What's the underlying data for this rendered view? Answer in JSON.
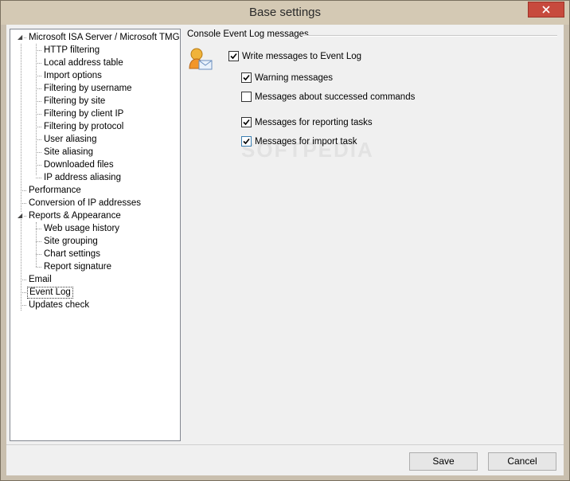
{
  "window": {
    "title": "Base settings"
  },
  "tree": {
    "nodes": [
      {
        "label": "Microsoft ISA Server / Microsoft TMG",
        "level": 0,
        "expanded": true
      },
      {
        "label": "HTTP filtering",
        "level": 1
      },
      {
        "label": "Local address table",
        "level": 1
      },
      {
        "label": "Import options",
        "level": 1
      },
      {
        "label": "Filtering by username",
        "level": 1
      },
      {
        "label": "Filtering by site",
        "level": 1
      },
      {
        "label": "Filtering by client IP",
        "level": 1
      },
      {
        "label": "Filtering by protocol",
        "level": 1
      },
      {
        "label": "User aliasing",
        "level": 1
      },
      {
        "label": "Site aliasing",
        "level": 1
      },
      {
        "label": "Downloaded files",
        "level": 1
      },
      {
        "label": "IP address aliasing",
        "level": 1
      },
      {
        "label": "Performance",
        "level": 0
      },
      {
        "label": "Conversion of IP addresses",
        "level": 0
      },
      {
        "label": "Reports & Appearance",
        "level": 0,
        "expanded": true
      },
      {
        "label": "Web usage history",
        "level": 1
      },
      {
        "label": "Site grouping",
        "level": 1
      },
      {
        "label": "Chart settings",
        "level": 1
      },
      {
        "label": "Report signature",
        "level": 1
      },
      {
        "label": "Email",
        "level": 0
      },
      {
        "label": "Event Log",
        "level": 0,
        "selected": true
      },
      {
        "label": "Updates check",
        "level": 0
      }
    ]
  },
  "event_log": {
    "group_title": "Console Event Log messages",
    "icon": "user-mail-icon",
    "options": [
      {
        "label": "Write messages to Event Log",
        "checked": true
      },
      {
        "label": "Warning messages",
        "checked": true
      },
      {
        "label": "Messages about successed commands",
        "checked": false
      },
      {
        "label": "Messages for reporting tasks",
        "checked": true
      },
      {
        "label": "Messages for import task",
        "checked": true
      }
    ]
  },
  "buttons": {
    "save": "Save",
    "cancel": "Cancel"
  },
  "watermark": "SOFTPEDIA",
  "colors": {
    "selection_border": "#333333",
    "close_button": "#c74a3d",
    "title_bar": "#d4c9b4"
  }
}
